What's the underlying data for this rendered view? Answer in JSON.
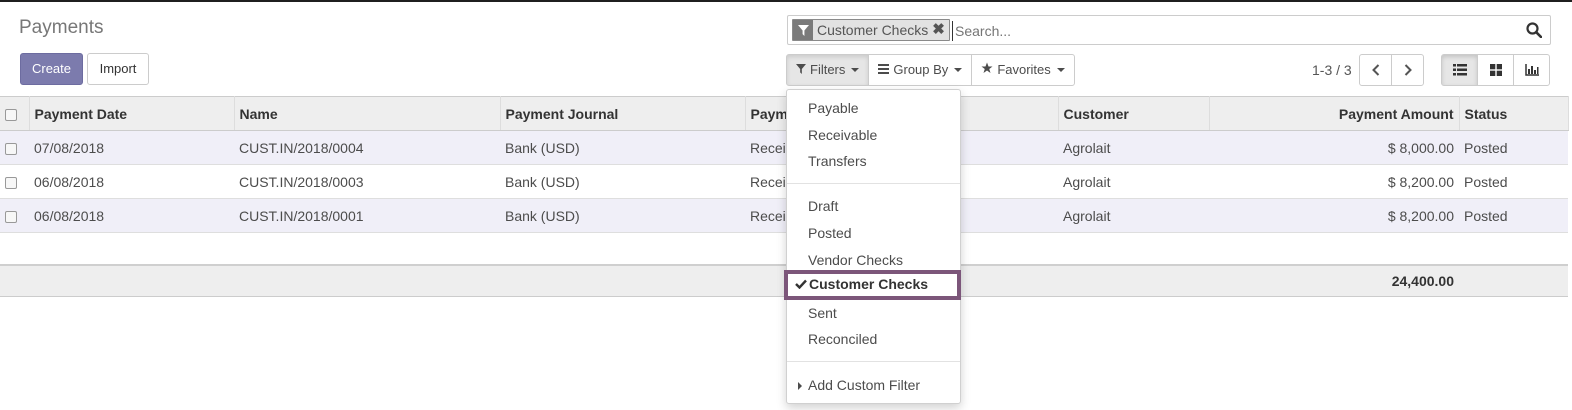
{
  "page": {
    "title": "Payments"
  },
  "toolbar": {
    "create_label": "Create",
    "import_label": "Import"
  },
  "search": {
    "facet_value": "Customer Checks",
    "facet_remove": "✖",
    "placeholder": "Search..."
  },
  "search_buttons": {
    "filters_label": "Filters",
    "group_by_label": "Group By",
    "favorites_label": "Favorites"
  },
  "pager": {
    "value": "1-3 / 3"
  },
  "table": {
    "columns": [
      "Payment Date",
      "Name",
      "Payment Journal",
      "Paym",
      "Customer",
      "Payment Amount",
      "Status"
    ],
    "rows": [
      {
        "date": "07/08/2018",
        "name": "CUST.IN/2018/0004",
        "journal": "Bank (USD)",
        "method": "Recei",
        "customer": "Agrolait",
        "amount": "$ 8,000.00",
        "status": "Posted"
      },
      {
        "date": "06/08/2018",
        "name": "CUST.IN/2018/0003",
        "journal": "Bank (USD)",
        "method": "Recei",
        "customer": "Agrolait",
        "amount": "$ 8,200.00",
        "status": "Posted"
      },
      {
        "date": "06/08/2018",
        "name": "CUST.IN/2018/0001",
        "journal": "Bank (USD)",
        "method": "Recei",
        "customer": "Agrolait",
        "amount": "$ 8,200.00",
        "status": "Posted"
      }
    ],
    "total": "24,400.00"
  },
  "filters_menu": {
    "group1": [
      "Payable",
      "Receivable",
      "Transfers"
    ],
    "group2": [
      "Draft",
      "Posted",
      "Vendor Checks",
      "Customer Checks",
      "Sent",
      "Reconciled"
    ],
    "checked_item": "Customer Checks",
    "add_custom": "Add Custom Filter"
  },
  "colors": {
    "primary": "#7c7bad",
    "highlight_border": "#7c567a",
    "stripe": "#f0eff8"
  }
}
